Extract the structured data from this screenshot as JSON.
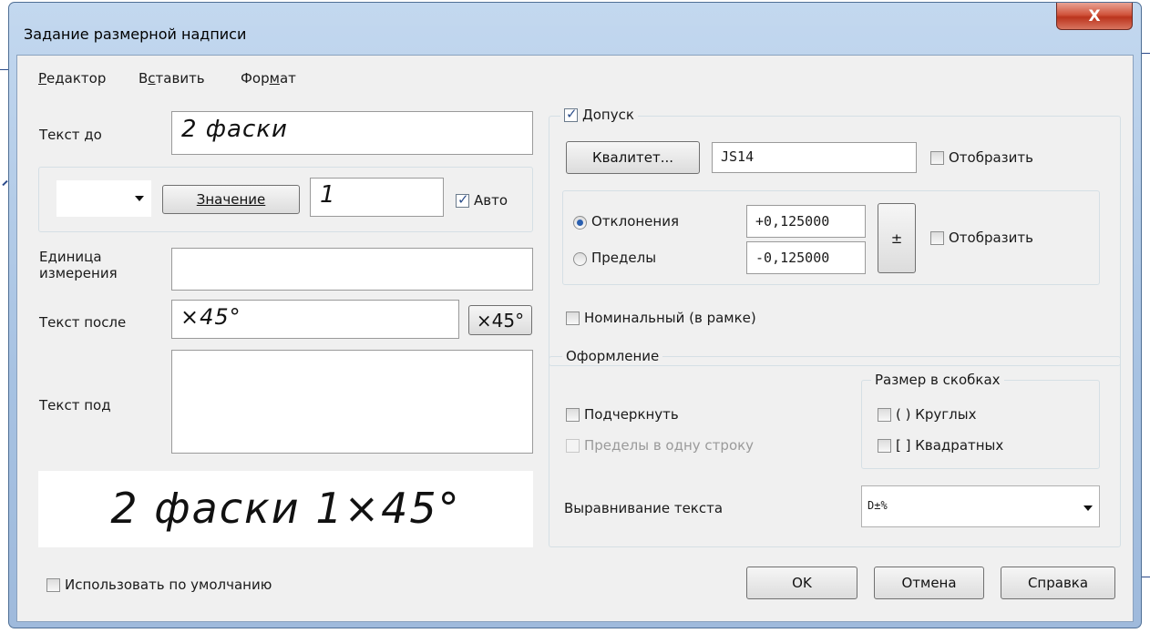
{
  "window": {
    "title": "Задание размерной надписи",
    "close_glyph": "X"
  },
  "menu": [
    {
      "label": "Редактор",
      "hotkey_index": 0
    },
    {
      "label": "Вставить",
      "hotkey_index": 1
    },
    {
      "label": "Формат",
      "hotkey_index": 3
    }
  ],
  "left": {
    "text_before_label": "Текст до",
    "text_before_value": "2 фаски",
    "symbol_select_value": "",
    "value_button_label": "Значение",
    "value_field": "1",
    "auto_label": "Авто",
    "auto_checked": true,
    "unit_label_1": "Единица",
    "unit_label_2": "измерения",
    "unit_value": "",
    "text_after_label": "Текст после",
    "text_after_value": "×45°",
    "x45_button_label": "×45°",
    "text_under_label": "Текст под",
    "text_under_value": "",
    "preview_text": "2 фаски 1×45°",
    "use_default_label": "Использовать по умолчанию",
    "use_default_checked": false
  },
  "tolerance": {
    "group_label": "Допуск",
    "group_checked": true,
    "qualitet_button_label": "Квалитет...",
    "qualitet_value": "JS14",
    "show_label": "Отобразить",
    "show_checked": false,
    "deviation_label": "Отклонения",
    "deviation_selected": true,
    "limits_label": "Пределы",
    "upper_value": "+0,125000",
    "lower_value": "-0,125000",
    "plusminus_label": "±",
    "show2_label": "Отобразить",
    "show2_checked": false,
    "nominal_label": "Номинальный (в рамке)",
    "nominal_checked": false
  },
  "format": {
    "group_label": "Оформление",
    "brackets_group_label": "Размер в скобках",
    "underline_label": "Подчеркнуть",
    "underline_checked": false,
    "limits_one_line_label": "Пределы в одну строку",
    "round_label": "( ) Круглых",
    "square_label": "[ ] Квадратных",
    "align_label": "Выравнивание текста",
    "align_value": "D±%"
  },
  "buttons": {
    "ok": "OK",
    "cancel": "Отмена",
    "help": "Справка"
  },
  "colors": {
    "title_gradient": "#b9d1ea",
    "close_red": "#c9432c",
    "accent_check": "#2d4e8a"
  }
}
